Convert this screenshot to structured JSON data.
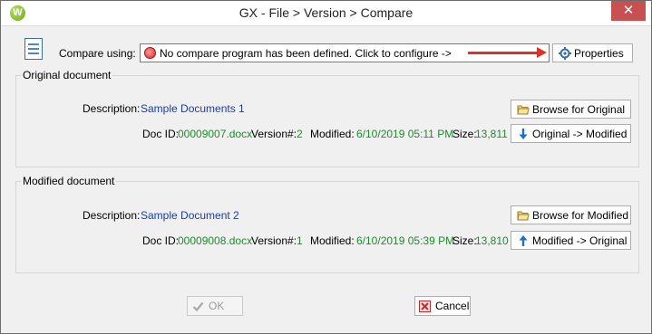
{
  "window": {
    "title": "GX - File > Version > Compare",
    "app_icon_letter": "W",
    "close_glyph": "✕"
  },
  "compare": {
    "label": "Compare using:",
    "value": "No compare program has been defined.  Click to configure ->",
    "properties_button": "Properties"
  },
  "original": {
    "group_title": "Original document",
    "description_label": "Description:",
    "description": "Sample Documents 1",
    "doc_id_label": "Doc ID:",
    "doc_id": "00009007.docx",
    "version_label": "Version#:",
    "version": "2",
    "modified_label": "Modified:",
    "modified": "6/10/2019 05:11 PM",
    "size_label": "Size:",
    "size": "13,811",
    "browse_button": "Browse for Original",
    "transfer_button": "Original -> Modified"
  },
  "modified": {
    "group_title": "Modified document",
    "description_label": "Description:",
    "description": "Sample Document 2",
    "doc_id_label": "Doc ID:",
    "doc_id": "00009008.docx",
    "version_label": "Version#:",
    "version": "1",
    "modified_label": "Modified:",
    "modified": "6/10/2019 05:39 PM",
    "size_label": "Size:",
    "size": "13,810",
    "browse_button": "Browse for Modified",
    "transfer_button": "Modified -> Original"
  },
  "footer": {
    "ok_button": "OK",
    "cancel_button": "Cancel"
  },
  "icons": {
    "doc": "compare-document-icon",
    "properties": "gear-icon",
    "browse": "folder-open-icon",
    "down": "arrow-down-icon",
    "up": "arrow-up-icon",
    "ok": "checkmark-icon",
    "cancel": "cancel-icon",
    "status": "red-circle-icon"
  },
  "colors": {
    "link_blue": "#1a3ea8",
    "value_green": "#1e8a2e",
    "annotation_arrow": "#d8342c",
    "close_red": "#c75050"
  }
}
